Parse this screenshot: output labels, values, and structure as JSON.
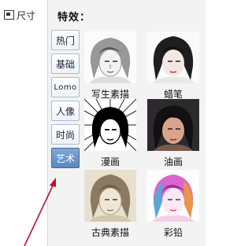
{
  "toolbar": {
    "size_label": "尺寸"
  },
  "panel": {
    "title": "特效："
  },
  "tabs": [
    {
      "label": "热门",
      "active": false
    },
    {
      "label": "基础",
      "active": false
    },
    {
      "label": "Lomo",
      "active": false
    },
    {
      "label": "人像",
      "active": false
    },
    {
      "label": "时尚",
      "active": false
    },
    {
      "label": "艺术",
      "active": true
    }
  ],
  "effects": [
    {
      "label": "写生素描",
      "icon": "sketch-portrait"
    },
    {
      "label": "蜡笔",
      "icon": "crayon-portrait"
    },
    {
      "label": "漫画",
      "icon": "comic-portrait"
    },
    {
      "label": "油画",
      "icon": "oil-painting-portrait"
    },
    {
      "label": "古典素描",
      "icon": "classic-sketch-portrait"
    },
    {
      "label": "彩铅",
      "icon": "color-pencil-portrait"
    }
  ],
  "colors": {
    "active_tab": "#6a94c9",
    "arrow": "#c0102a"
  }
}
